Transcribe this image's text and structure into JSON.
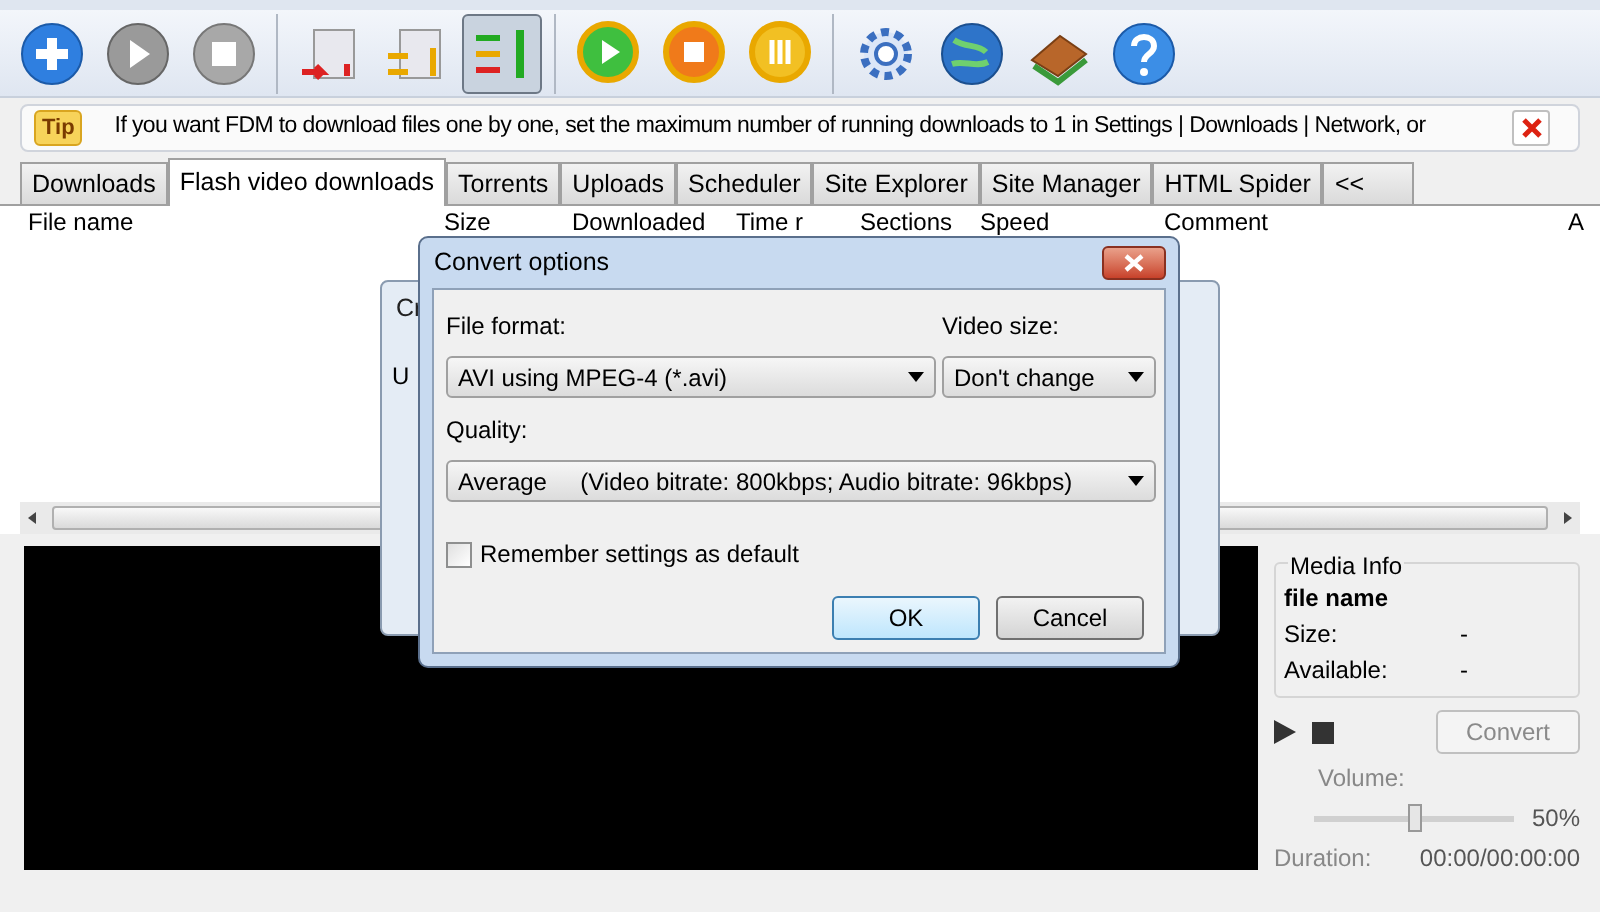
{
  "toolbar": [
    {
      "kind": "add",
      "selected": false
    },
    {
      "kind": "play",
      "selected": false
    },
    {
      "kind": "stop",
      "selected": false
    },
    {
      "kind": "speed-low",
      "selected": false
    },
    {
      "kind": "speed-mid",
      "selected": false
    },
    {
      "kind": "speed-high",
      "selected": true
    },
    {
      "kind": "start-all",
      "selected": false
    },
    {
      "kind": "stop-all",
      "selected": false
    },
    {
      "kind": "pause-all",
      "selected": false
    },
    {
      "kind": "settings",
      "selected": false
    },
    {
      "kind": "globe",
      "selected": false
    },
    {
      "kind": "book",
      "selected": false
    },
    {
      "kind": "help",
      "selected": false
    }
  ],
  "tip": {
    "badge": "Tip",
    "text": "If you want FDM to download files one by one, set the maximum number of running downloads to 1 in Settings | Downloads | Network, or"
  },
  "tabs": [
    {
      "label": "Downloads",
      "selected": false
    },
    {
      "label": "Flash video downloads",
      "selected": true
    },
    {
      "label": "Torrents",
      "selected": false
    },
    {
      "label": "Uploads",
      "selected": false
    },
    {
      "label": "Scheduler",
      "selected": false
    },
    {
      "label": "Site Explorer",
      "selected": false
    },
    {
      "label": "Site Manager",
      "selected": false
    },
    {
      "label": "HTML Spider",
      "selected": false
    },
    {
      "label": "<<",
      "selected": false
    }
  ],
  "table": {
    "columns": [
      "File name",
      "Size",
      "Downloaded",
      "Time r",
      "Sections",
      "Speed",
      "Comment",
      "A"
    ]
  },
  "background_dialog": {
    "title": "Cr",
    "label": "U"
  },
  "dialog": {
    "title": "Convert options",
    "file_format_label": "File format:",
    "file_format": "AVI using MPEG-4 (*.avi)",
    "video_size_label": "Video size:",
    "video_size": "Don't change",
    "quality_label": "Quality:",
    "quality": "Average     (Video bitrate: 800kbps; Audio bitrate: 96kbps)",
    "remember": {
      "label": "Remember settings as default",
      "checked": false
    },
    "ok": "OK",
    "cancel": "Cancel"
  },
  "media_info": {
    "title": "Media Info",
    "file_name": "file name",
    "size_label": "Size:",
    "size": "-",
    "available_label": "Available:",
    "available": "-",
    "convert": "Convert",
    "volume_label": "Volume:",
    "volume": {
      "level": 0.5
    },
    "volume_reading": "50%",
    "duration_label": "Duration:",
    "duration": "00:00/00:00:00"
  }
}
